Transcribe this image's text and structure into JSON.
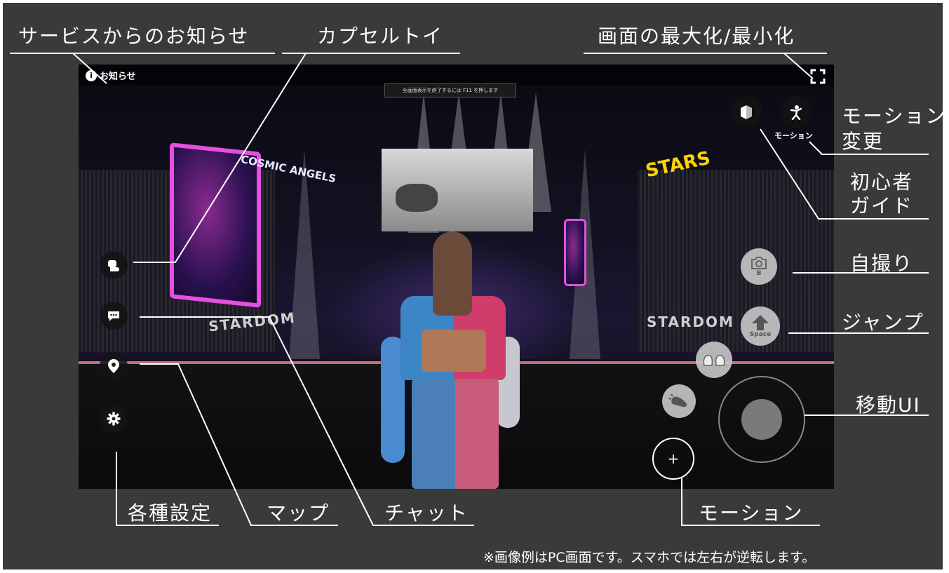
{
  "scene": {
    "news_label": "お知らせ",
    "motion_label": "モーション",
    "notice_text": "全画面表示を終了するには F11 を押します",
    "jump_key": "Space",
    "selfie_key": "B",
    "logos": [
      "COSMIC ANGELS",
      "STARS",
      "STARDOM",
      "STARDOM"
    ]
  },
  "annotations": {
    "service_notice": "サービスからのお知らせ",
    "capsule_toy": "カプセルトイ",
    "fullscreen": "画面の最大化/最小化",
    "motion_change_1": "モーション",
    "motion_change_2": "変更",
    "beginner_guide_1": "初心者",
    "beginner_guide_2": "ガイド",
    "selfie": "自撮り",
    "jump": "ジャンプ",
    "move_ui": "移動UI",
    "motion": "モーション",
    "chat": "チャット",
    "map": "マップ",
    "settings": "各種設定"
  },
  "footnote": "※画像例はPC画面です。スマホでは左右が逆転します。",
  "colors": {
    "frame": "#3a3a3a",
    "accent_pink": "#e64fe0",
    "rope": "#e57b9a"
  }
}
